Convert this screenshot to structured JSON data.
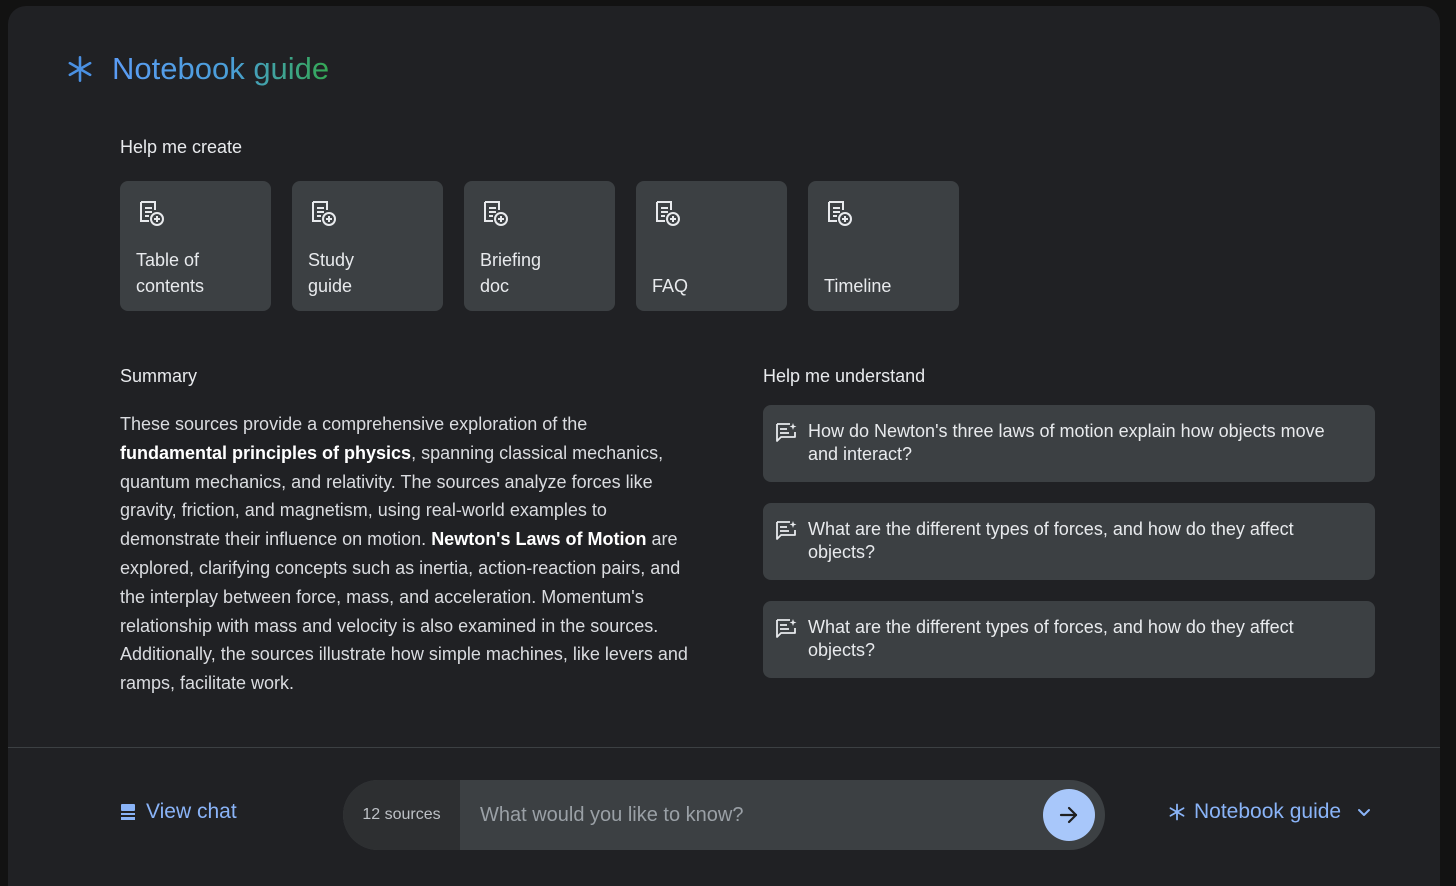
{
  "header": {
    "title": "Notebook guide"
  },
  "help_create": {
    "label": "Help me create",
    "cards": [
      {
        "line1": "Table of",
        "line2": "contents"
      },
      {
        "line1": "Study",
        "line2": "guide"
      },
      {
        "line1": "Briefing",
        "line2": "doc"
      },
      {
        "line1": "",
        "line2": "FAQ"
      },
      {
        "line1": "",
        "line2": "Timeline"
      }
    ]
  },
  "summary": {
    "label": "Summary",
    "p1": "These sources provide a comprehensive exploration of the ",
    "b1": "fundamental principles of physics",
    "p2": ", spanning classical mechanics, quantum mechanics, and relativity. The sources analyze forces like gravity, friction, and magnetism, using real-world examples to demonstrate their influence on motion. ",
    "b2": "Newton's Laws of Motion",
    "p3": " are explored, clarifying concepts such as inertia, action-reaction pairs, and the interplay between force, mass, and acceleration. Momentum's relationship with mass and velocity is also examined in the sources. Additionally, the sources illustrate how simple machines, like levers and ramps, facilitate work."
  },
  "help_understand": {
    "label": "Help me understand",
    "questions": [
      "How do Newton's three laws of motion explain how objects move and interact?",
      "What are the different types of forces, and how do they affect objects?",
      "What are the different types of forces, and how do they affect objects?"
    ]
  },
  "footer": {
    "view_chat": "View chat",
    "sources": "12 sources",
    "input_placeholder": "What would you like to know?",
    "notebook_guide": "Notebook guide"
  },
  "colors": {
    "background": "#202124",
    "card": "#3c4043",
    "accent": "#8ab4f8",
    "send_button": "#a8c7fa"
  }
}
